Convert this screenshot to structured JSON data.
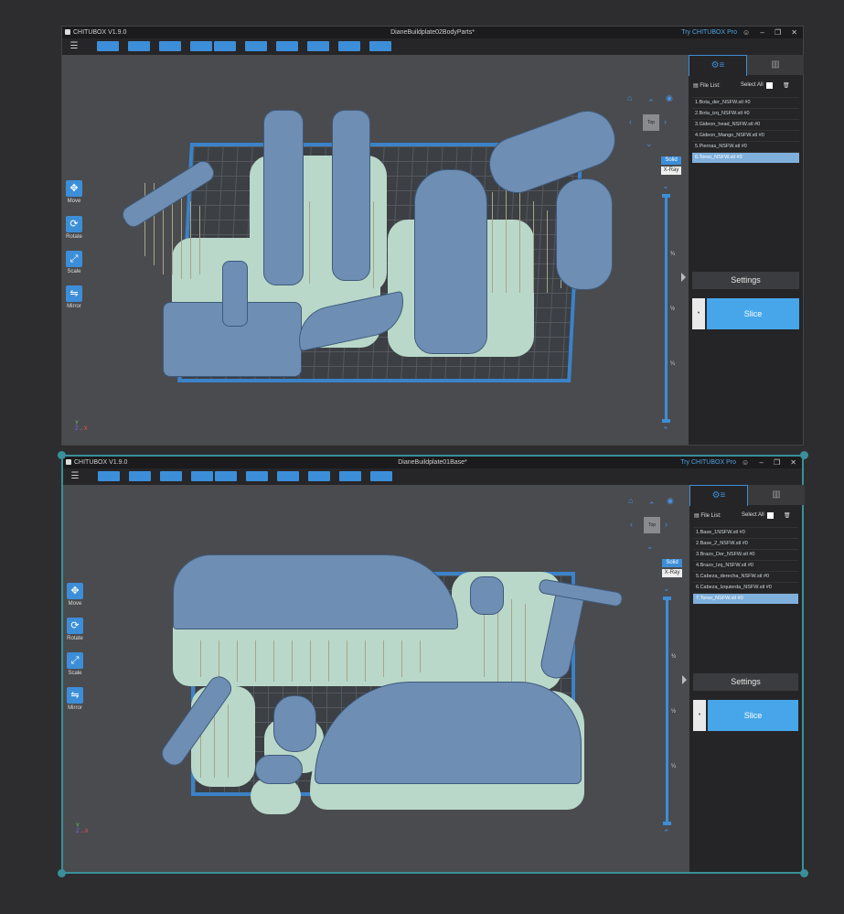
{
  "windows": [
    {
      "app_title": "CHITUBOX V1.9.0",
      "doc_title": "DianeBuildplate02BodyParts*",
      "pro_link": "Try CHITUBOX Pro",
      "tools": [
        {
          "label": "Move",
          "icon": "move-icon",
          "glyph": "✥"
        },
        {
          "label": "Rotate",
          "icon": "rotate-icon",
          "glyph": "⟳"
        },
        {
          "label": "Scale",
          "icon": "scale-icon",
          "glyph": "⤢"
        },
        {
          "label": "Mirror",
          "icon": "mirror-icon",
          "glyph": "⇋"
        }
      ],
      "view": {
        "top_label": "Top",
        "solid": "Solid",
        "xray": "X-Ray"
      },
      "ticks": [
        "¾",
        "½",
        "¼"
      ],
      "file_list_label": "File List:",
      "select_all_label": "Select All",
      "files": [
        "1.Bota_der_NSFW.stl #0",
        "2.Bota_izq_NSFW.stl #0",
        "3.Gideon_head_NSFW.stl #0",
        "4.Gideon_Mango_NSFW.stl #0",
        "5.Piernas_NSFW.stl #0",
        "6.Torso_NSFW.stl #0"
      ],
      "selected_file": 5,
      "settings_label": "Settings",
      "slice_label": "Slice"
    },
    {
      "app_title": "CHITUBOX V1.9.0",
      "doc_title": "DianeBuildplate01Base*",
      "pro_link": "Try CHITUBOX Pro",
      "tools": [
        {
          "label": "Move",
          "icon": "move-icon",
          "glyph": "✥"
        },
        {
          "label": "Rotate",
          "icon": "rotate-icon",
          "glyph": "⟳"
        },
        {
          "label": "Scale",
          "icon": "scale-icon",
          "glyph": "⤢"
        },
        {
          "label": "Mirror",
          "icon": "mirror-icon",
          "glyph": "⇋"
        }
      ],
      "view": {
        "top_label": "Top",
        "solid": "Solid",
        "xray": "X-Ray"
      },
      "ticks": [
        "¾",
        "½",
        "¼"
      ],
      "file_list_label": "File List:",
      "select_all_label": "Select All",
      "files": [
        "1.Base_1NSFW.stl #0",
        "2.Base_2_NSFW.stl #0",
        "3.Brazo_Der_NSFW.stl #0",
        "4.Brazo_Izq_NSFW.stl #0",
        "5.Cabeza_derecha_NSFW.stl #0",
        "6.Cabeza_Izquierda_NSFW.stl #0",
        "7.Torso_NSFW.stl #0"
      ],
      "selected_file": 6,
      "settings_label": "Settings",
      "slice_label": "Slice"
    }
  ],
  "colors": {
    "accent": "#3d8ed8",
    "slice": "#47a6e9",
    "model": "#6e8eb4",
    "halo": "#b9d8c9",
    "selection": "#3a8f9a"
  }
}
